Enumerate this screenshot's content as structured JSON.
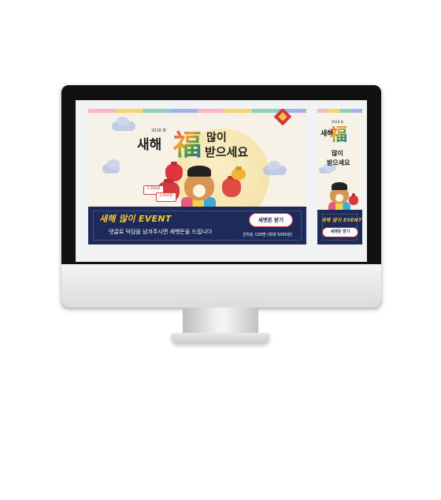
{
  "colors": {
    "navy": "#1e2a5a",
    "gold_text": "#f5c92a",
    "cream_bg": "#f7f2e8",
    "stripe": [
      "#f5b8c4",
      "#f7d46b",
      "#8fd0c1",
      "#9fb5e8",
      "#f5b8c4",
      "#f7d46b"
    ]
  },
  "main_banner": {
    "year": "2018 年",
    "headline_left": "새해",
    "hanja": "福",
    "headline_right_top": "많이",
    "headline_right_bottom": "받으세요",
    "coupon_1": "5,000원",
    "coupon_2": "3,000원",
    "event_title": "새해 많이 EVENT",
    "event_desc": "댓글로 덕담을 남겨주시면 세뱃돈을 드립니다",
    "cta_label": "세뱃돈 받기",
    "event_note": "선착순 100명 (최대 5000원)"
  },
  "side_banner": {
    "year": "2018 年",
    "headline_left": "새해",
    "hanja": "福",
    "headline_right_top": "많이",
    "headline_right_bottom": "받으세요",
    "event_title": "새해 많이 EVENT",
    "cta_label": "세뱃돈 받기"
  },
  "icons": [
    "lucky-pouch-icon",
    "dog-character-icon",
    "cloud-icon",
    "moon-icon",
    "diamond-ornament-icon"
  ]
}
